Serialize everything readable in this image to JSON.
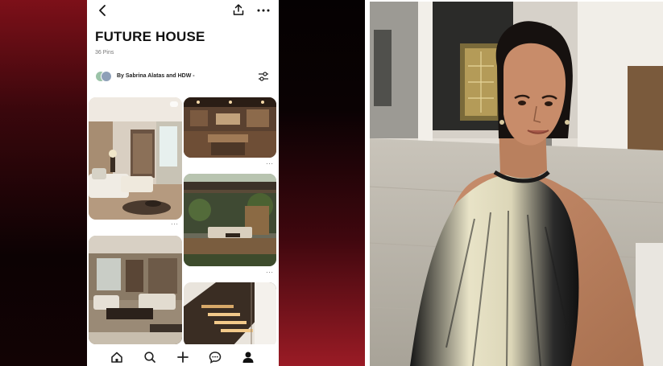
{
  "board": {
    "title": "FUTURE HOUSE",
    "pin_count": "36 Pins",
    "collaborators": "By Sabrina Alatas and HDW -"
  },
  "icons": {
    "back": "chevron-left-icon",
    "share": "share-icon",
    "more": "more-dots-icon",
    "filter": "filter-sliders-icon"
  },
  "pins": [
    {
      "subject": "living-room"
    },
    {
      "subject": "kitchen"
    },
    {
      "subject": "outdoor-pergola"
    },
    {
      "subject": "living-room-2"
    },
    {
      "subject": "staircase"
    }
  ],
  "pin_menu_glyph": "···",
  "nav": {
    "items": [
      "home-icon",
      "search-icon",
      "create-plus-icon",
      "messages-icon",
      "profile-icon"
    ],
    "active": "profile-icon"
  },
  "colors": {
    "accent_red": "#8e1420",
    "text_dark": "#111111",
    "muted": "#777777"
  }
}
